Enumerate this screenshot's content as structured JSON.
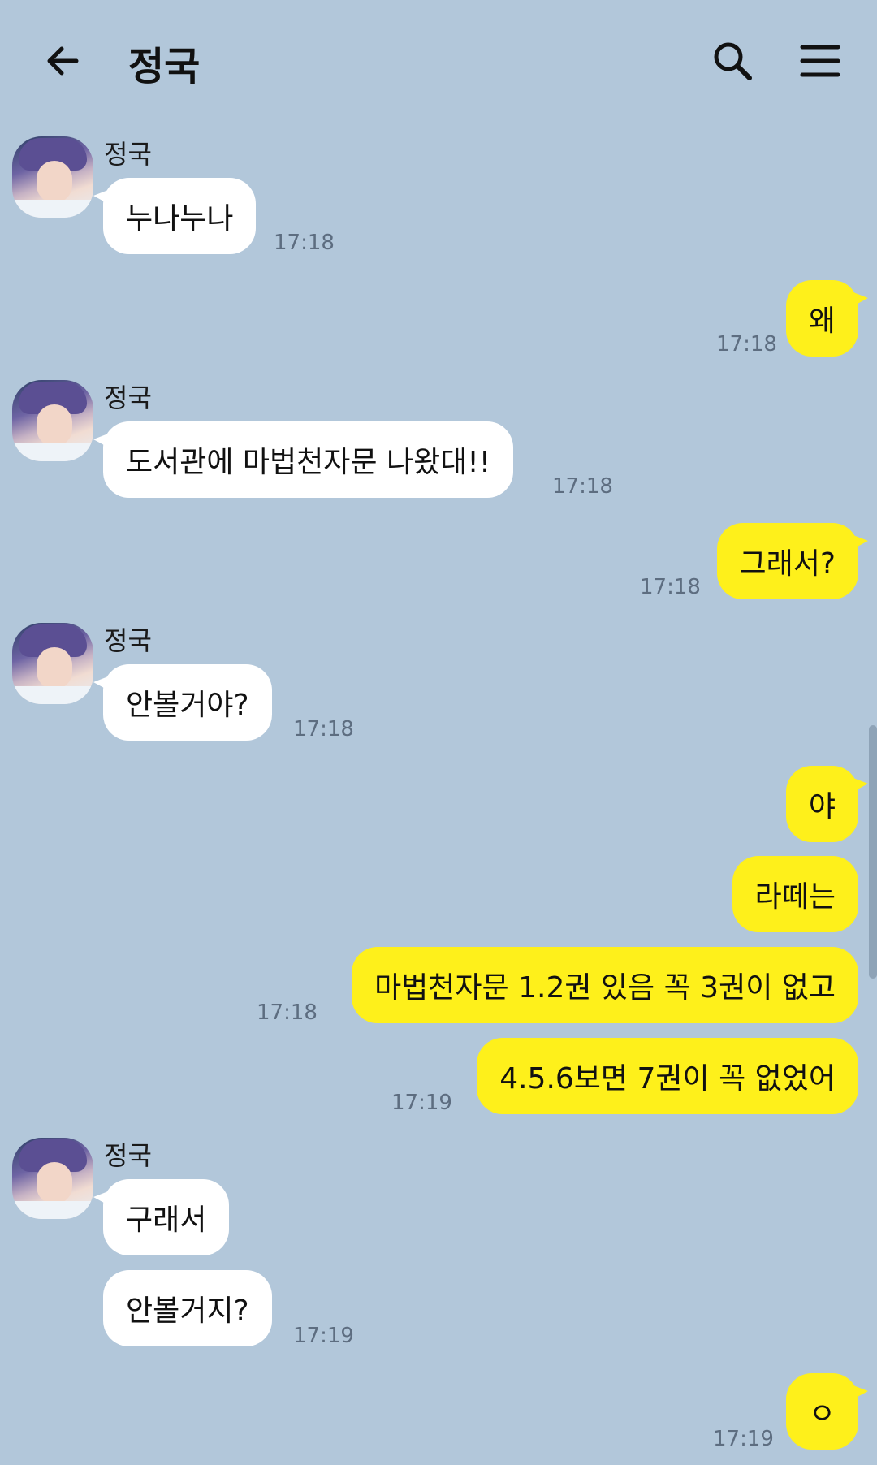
{
  "header": {
    "title": "정국",
    "back_icon": "arrow-left-icon",
    "search_icon": "search-icon",
    "menu_icon": "hamburger-menu-icon"
  },
  "colors": {
    "background": "#b2c7da",
    "incoming_bubble": "#ffffff",
    "outgoing_bubble": "#fef01b",
    "timestamp": "#5d6d80"
  },
  "messages": [
    {
      "sender": "정국",
      "text": "누나누나",
      "time": "17:18"
    },
    {
      "text": "왜",
      "time": "17:18"
    },
    {
      "sender": "정국",
      "text": "도서관에 마법천자문 나왔대!!",
      "time": "17:18"
    },
    {
      "text": "그래서?",
      "time": "17:18"
    },
    {
      "sender": "정국",
      "text": "안볼거야?",
      "time": "17:18"
    },
    {
      "text": "야"
    },
    {
      "text": "라떼는"
    },
    {
      "text": "마법천자문 1.2권 있음 꼭 3권이 없고",
      "time": "17:18"
    },
    {
      "text": "4.5.6보면 7권이 꼭 없었어",
      "time": "17:19"
    },
    {
      "sender": "정국",
      "text": "구래서"
    },
    {
      "text": "안볼거지?",
      "time": "17:19"
    },
    {
      "text": "ㅇ",
      "time": "17:19"
    }
  ]
}
